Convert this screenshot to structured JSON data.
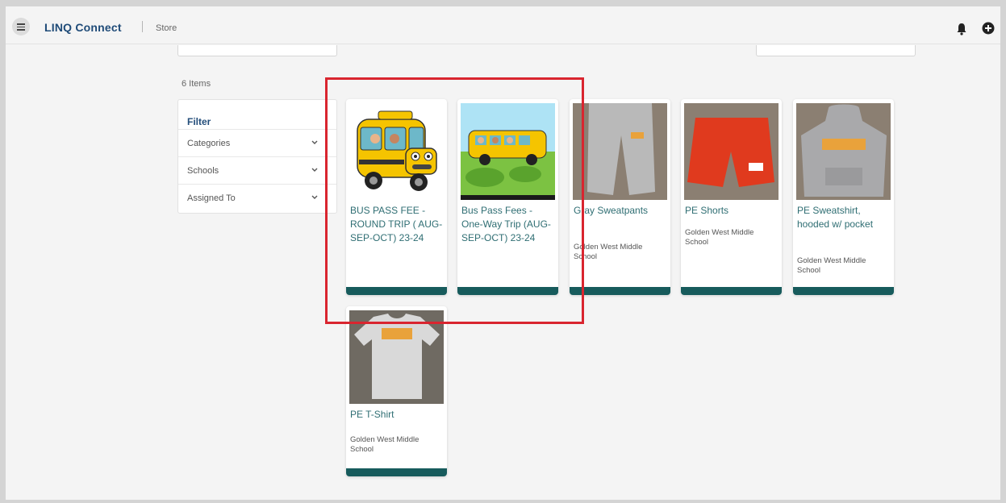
{
  "header": {
    "brand": "LINQ Connect",
    "breadcrumb": "Store",
    "icons": [
      "menu-icon",
      "bell-icon",
      "add-circle-icon"
    ]
  },
  "store": {
    "item_count": "6 Items"
  },
  "filter": {
    "title": "Filter",
    "rows": [
      {
        "label": "Categories"
      },
      {
        "label": "Schools"
      },
      {
        "label": "Assigned To"
      }
    ]
  },
  "products": [
    {
      "title": "BUS PASS FEE - ROUND TRIP ( AUG-SEP-OCT) 23-24",
      "school": "",
      "image": "school-bus-front"
    },
    {
      "title": "Bus Pass Fees - One-Way Trip (AUG- SEP-OCT) 23-24",
      "school": "",
      "image": "school-bus-side"
    },
    {
      "title": "Gray Sweatpants",
      "school": "Golden West Middle School",
      "image": "gray-sweatpants"
    },
    {
      "title": "PE Shorts",
      "school": "Golden West Middle School",
      "image": "red-shorts"
    },
    {
      "title": "PE Sweatshirt, hooded w/ pocket",
      "school": "Golden West Middle School",
      "image": "gray-hoodie"
    },
    {
      "title": "PE T-Shirt",
      "school": "Golden West Middle School",
      "image": "gray-tshirt"
    }
  ],
  "colors": {
    "brand": "#1f4b78",
    "product_title": "#2f6e73",
    "card_bar": "#175b5c",
    "highlight": "#d9252f"
  }
}
